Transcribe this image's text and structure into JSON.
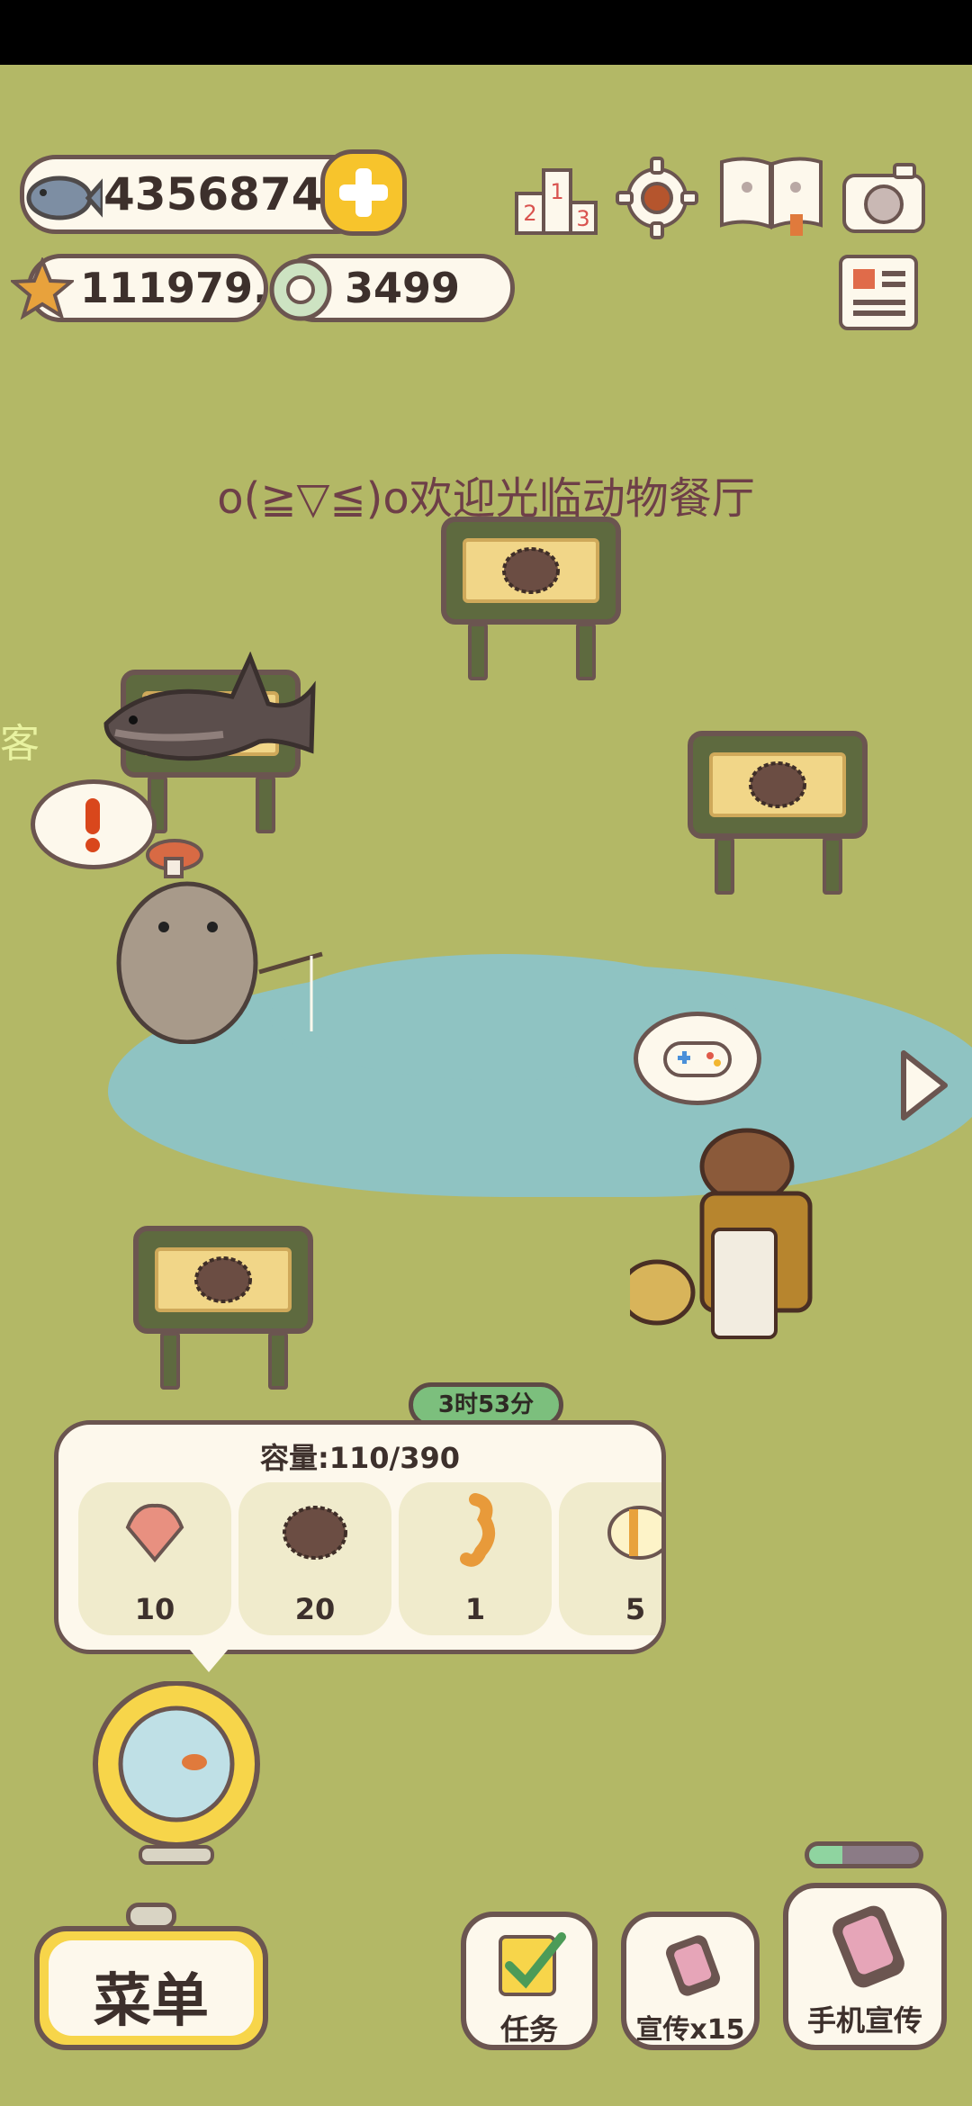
{
  "currency": {
    "fish": "4356874",
    "stars": "111979.5",
    "coins": "3499"
  },
  "welcome_text": "o(≧▽≦)o欢迎光临动物餐厅",
  "side_text": "客",
  "timer": "3时53分",
  "storage": {
    "capacity_label": "容量:110/390",
    "items": [
      {
        "name": "shell",
        "count": "10"
      },
      {
        "name": "sea-urchin",
        "count": "20"
      },
      {
        "name": "seahorse",
        "count": "1"
      },
      {
        "name": "butterfly-fish",
        "count": "5"
      }
    ]
  },
  "buttons": {
    "menu": "菜单",
    "tasks": "任务",
    "promote": "宣传x15",
    "phone_promote": "手机宣传"
  },
  "progress": {
    "phone_promote_fraction": 0.3
  },
  "icons": {
    "fish": "fish-icon",
    "star": "star-icon",
    "coin": "coin-icon",
    "plus": "plus-icon",
    "ranking": "ranking-icon",
    "settings": "gear-icon",
    "book": "book-icon",
    "camera": "camera-icon",
    "news": "newspaper-icon"
  },
  "colors": {
    "background": "#b3b866",
    "pond": "#8fc3c2",
    "accent_yellow": "#f7d54a",
    "outline": "#6b5550"
  }
}
